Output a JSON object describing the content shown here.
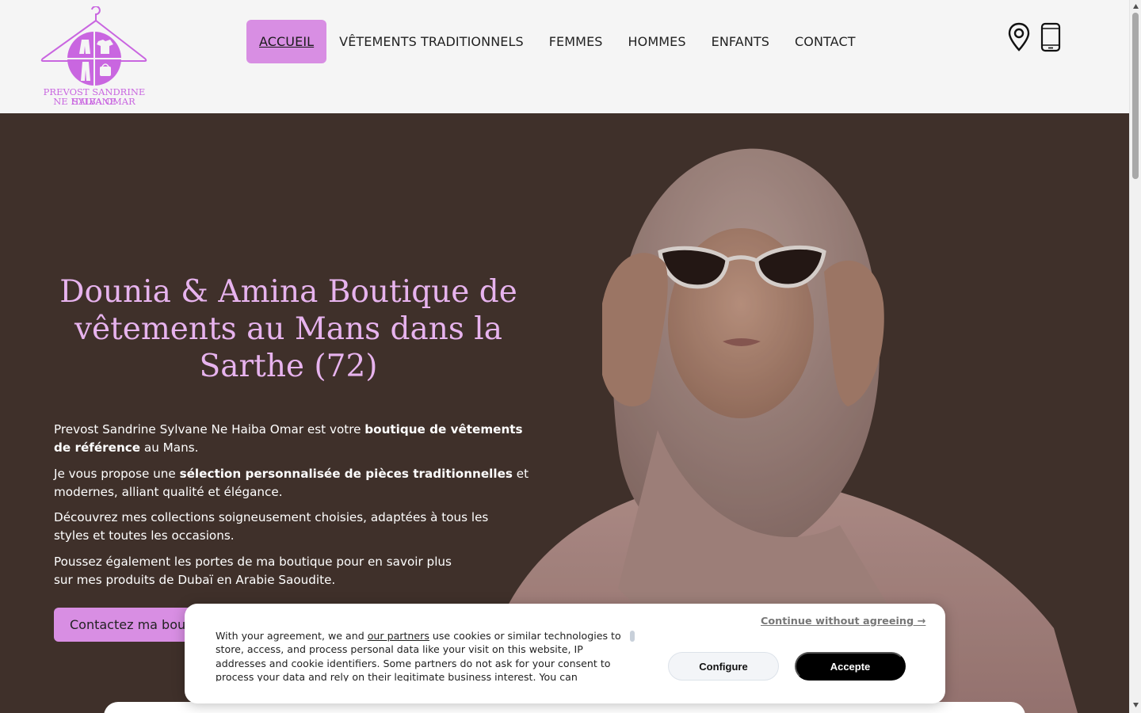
{
  "brand": {
    "line1": "PREVOST SANDRINE SYLVANE",
    "line2": "NE HAIBA OMAR",
    "color": "#c966e0"
  },
  "nav": {
    "items": [
      {
        "label": "ACCUEIL",
        "active": true
      },
      {
        "label": "VÊTEMENTS TRADITIONNELS"
      },
      {
        "label": "FEMMES"
      },
      {
        "label": "HOMMES"
      },
      {
        "label": "ENFANTS"
      },
      {
        "label": "CONTACT"
      }
    ],
    "active_color": "#d88ee3"
  },
  "header_icons": [
    "map-pin-icon",
    "mobile-phone-icon"
  ],
  "hero": {
    "title": "Dounia & Amina Boutique de vêtements au Mans dans la Sarthe (72)",
    "p1": {
      "a": "Prevost Sandrine Sylvane Ne Haiba Omar est votre ",
      "b": "boutique de vêtements de référence",
      "c": " au Mans."
    },
    "p2": {
      "a": "Je vous propose une ",
      "b": "sélection personnalisée de pièces traditionnelles",
      "c": " et modernes, alliant qualité et élégance."
    },
    "p3": "Découvrez mes collections soigneusement choisies, adaptées à tous les styles et toutes les occasions.",
    "p4a": "Poussez également les portes de ma boutique pour en savoir plus",
    "p4b": "sur mes produits de Dubaï en Arabie Saoudite.",
    "cta": "Contactez ma boutique",
    "background": "#3f302b",
    "title_color": "#e7b3ee"
  },
  "cookie": {
    "text_before": "With your agreement, we and ",
    "partners_link": "our partners",
    "text_after": " use cookies or similar technologies to store, access, and process personal data like your visit on this website, IP addresses and cookie identifiers. Some partners do not ask for your consent to process your data and rely on their legitimate business interest. You can",
    "continue": "Continue without agreeing →",
    "configure": "Configure",
    "accept": "Accepte"
  }
}
